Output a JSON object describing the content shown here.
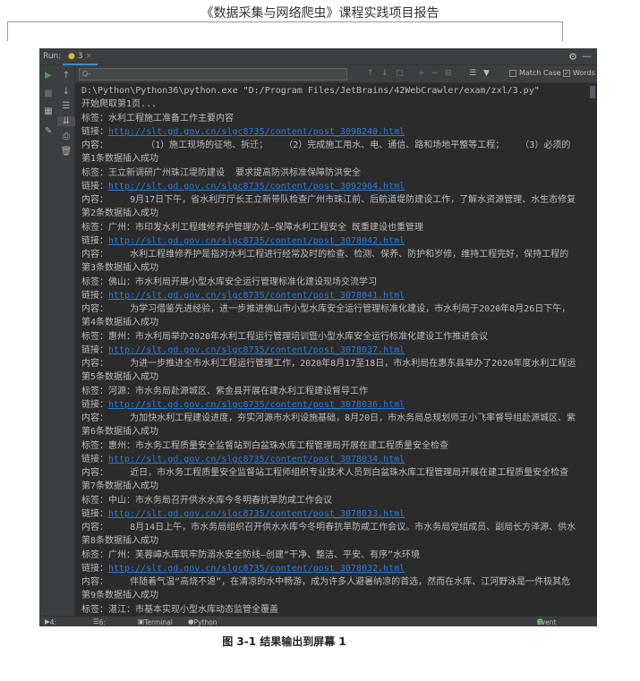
{
  "doc_header": "《数据采集与网络爬虫》课程实践项目报告",
  "caption": "图 3-1 结果输出到屏幕 1",
  "ide": {
    "run_label": "Run:",
    "tab_label": "3",
    "search_placeholder": "Q-",
    "match_case_label": "Match Case",
    "match_case_checked": false,
    "words_label": "Words",
    "words_checked": true,
    "status": {
      "run": "4: Run",
      "todo": "6: TODO",
      "terminal": "Terminal",
      "python_console": "Python Console",
      "event_log": "Event Log"
    },
    "colors": {
      "background": "#2b2b2b",
      "text": "#bbbbbb",
      "link": "#287bde",
      "run": "#499c54"
    }
  },
  "console": {
    "command": "D:\\Python\\Python36\\python.exe \"D:/Program Files/JetBrains/42WebCrawler/exam/zxl/3.py\"",
    "start": "开始爬取第1页...",
    "records": [
      {
        "tag": "标签：水利工程施工准备工作主要内容",
        "link_label": "链接：",
        "url": "http://slt.gd.gov.cn/slgc8735/content/post_3098240.html",
        "content": "内容：       （1）施工现场的征地、拆迁；   （2）完成施工用水、电、通信、路和场地平整等工程；   （3）必须的",
        "ok": "第1条数据插入成功"
      },
      {
        "tag": "标签：王立新调研广州珠江堤防建设  要求提高防洪标准保障防洪安全",
        "link_label": "链接：",
        "url": "http://slt.gd.gov.cn/slgc8735/content/post_3092964.html",
        "content": "内容：    9月17日下午，省水利厅厅长王立新带队检查广州市珠江前、后航道堤防建设工作，了解水资源管理、水生态修复",
        "ok": "第2条数据插入成功"
      },
      {
        "tag": "标签：广州：市印发水利工程维修养护管理办法—保障水利工程安全 既重建设也重管理",
        "link_label": "链接：",
        "url": "http://slt.gd.gov.cn/slgc8735/content/post_3078042.html",
        "content": "内容：    水利工程维修养护是指对水利工程进行经常及时的检查、检测、保养、防护和岁修，维持工程完好，保持工程的",
        "ok": "第3条数据插入成功"
      },
      {
        "tag": "标签：佛山：市水利局开展小型水库安全运行管理标准化建设现场交流学习",
        "link_label": "链接：",
        "url": "http://slt.gd.gov.cn/slgc8735/content/post_3078041.html",
        "content": "内容：    为学习借鉴先进经验，进一步推进佛山市小型水库安全运行管理标准化建设，市水利局于2020年8月26日下午，",
        "ok": "第4条数据插入成功"
      },
      {
        "tag": "标签：惠州：市水利局举办2020年水利工程运行管理培训暨小型水库安全运行标准化建设工作推进会议",
        "link_label": "链接：",
        "url": "http://slt.gd.gov.cn/slgc8735/content/post_3078037.html",
        "content": "内容：    为进一步推进全市水利工程运行管理工作，2020年8月17至18日，市水利局在惠东县举办了2020年度水利工程运",
        "ok": "第5条数据插入成功"
      },
      {
        "tag": "标签：河源：市水务局赴源城区、紫金县开展在建水利工程建设督导工作",
        "link_label": "链接：",
        "url": "http://slt.gd.gov.cn/slgc8735/content/post_3078036.html",
        "content": "内容：    为加快水利工程建设进度，夯实河源市水利设施基础，8月20日，市水务局总规划师王小飞率督导组赴源城区、紫",
        "ok": "第6条数据插入成功"
      },
      {
        "tag": "标签：惠州：市水务工程质量安全监督站到白盆珠水库工程管理局开展在建工程质量安全检查",
        "link_label": "链接：",
        "url": "http://slt.gd.gov.cn/slgc8735/content/post_3078034.html",
        "content": "内容：    近日，市水务工程质量安全监督站工程师组织专业技术人员到白盆珠水库工程管理局开展在建工程质量安全检查",
        "ok": "第7条数据插入成功"
      },
      {
        "tag": "标签：中山：市水务局召开供水水库今冬明春抗旱防咸工作会议",
        "link_label": "链接：",
        "url": "http://slt.gd.gov.cn/slgc8735/content/post_3078033.html",
        "content": "内容：    8月14日上午，市水务局组织召开供水水库今冬明春抗旱防咸工作会议。市水务局党组成员、副局长方泽源、供水",
        "ok": "第8条数据插入成功"
      },
      {
        "tag": "标签：广州：芙蓉嶂水库筑牢防溺水安全防线—创建“干净、整洁、平安、有序”水环境",
        "link_label": "链接：",
        "url": "http://slt.gd.gov.cn/slgc8735/content/post_3078032.html",
        "content": "内容：    伴随着气温“高烧不退”，在清凉的水中畅游，成为许多人避暑纳凉的首选，然而在水库、江河野泳是一件极其危",
        "ok": "第9条数据插入成功"
      }
    ],
    "last_tag": "标签：湛江：市基本实现小型水库动态监管全覆盖"
  }
}
